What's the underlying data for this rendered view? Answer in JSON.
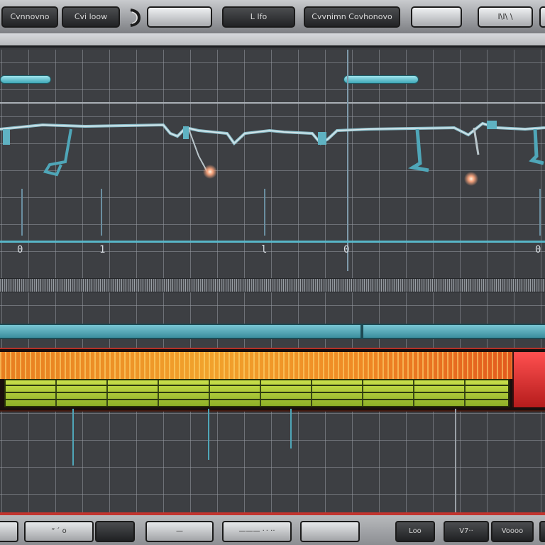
{
  "top_toolbar": {
    "buttons": [
      {
        "label": "Cvnnovno"
      },
      {
        "label": "Cvi loow"
      },
      {
        "label": ""
      },
      {
        "label": "L Ifo"
      },
      {
        "label": "Cvvnimn Covhonovo"
      },
      {
        "label": ""
      },
      {
        "label": "I\\I\\ \\"
      }
    ],
    "knob_icon": "rotary-knob-icon"
  },
  "editor": {
    "ruler_numbers": [
      "0",
      "1",
      "l",
      "0",
      "0"
    ],
    "colors": {
      "grid": "#969ba2",
      "background": "#3d3f43",
      "cyan": "#58b6c8",
      "meter_orange": "#f1a22c",
      "meter_green": "#a8c93a",
      "meter_peak": "#e22b2b"
    },
    "meter_level": 0.94
  },
  "bottom_toolbar": {
    "buttons": [
      {
        "label": ""
      },
      {
        "label": "“ ´ o"
      },
      {
        "label": ""
      },
      {
        "label": "—"
      },
      {
        "label": "——— · · ··"
      },
      {
        "label": ""
      },
      {
        "label": "Loo"
      },
      {
        "label": "V7··"
      },
      {
        "label": "Voooo"
      },
      {
        "label": ""
      }
    ]
  }
}
